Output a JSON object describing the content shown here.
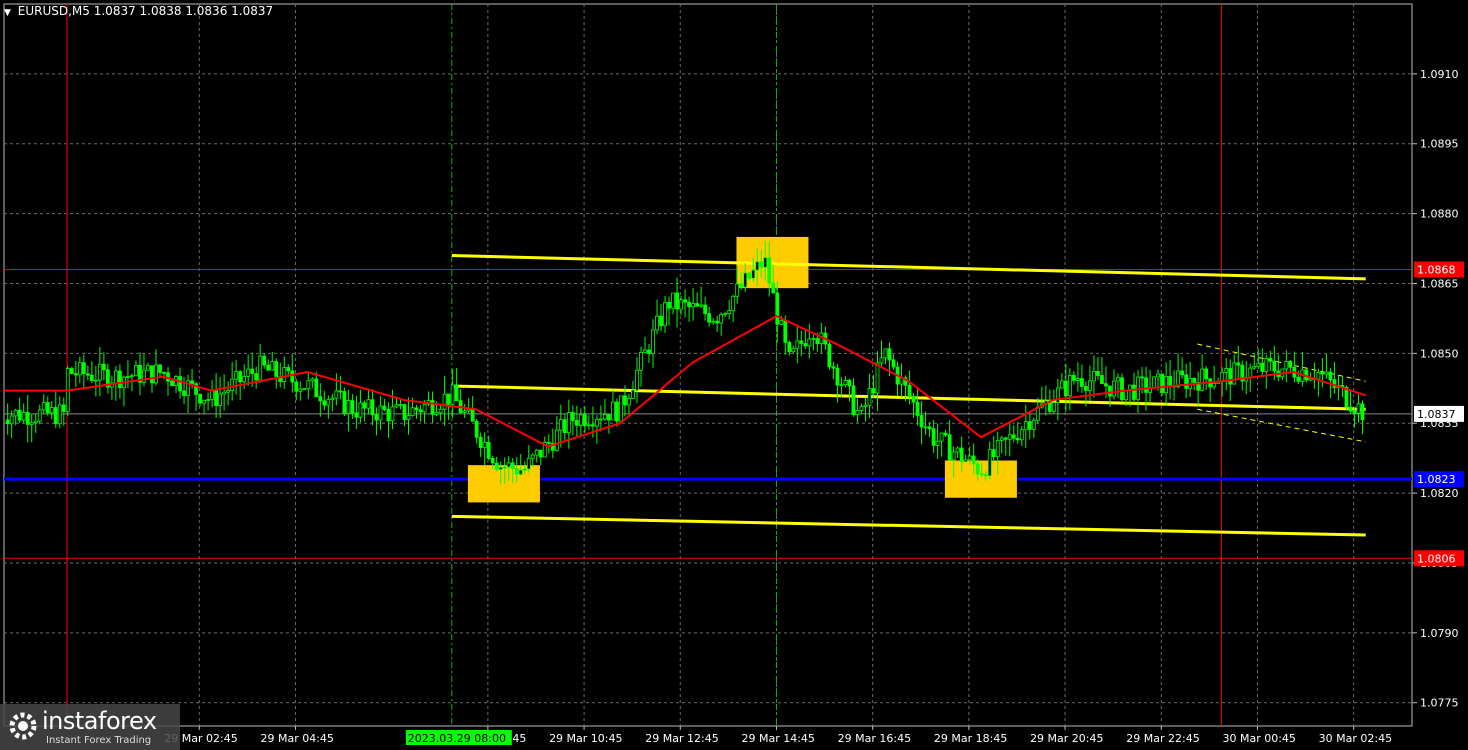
{
  "header": {
    "symbol_timeframe": "EURUSD,M5",
    "ohlc": "1.0837 1.0838 1.0836 1.0837"
  },
  "logo": {
    "brand": "instaforex",
    "tagline": "Instant Forex Trading"
  },
  "chart_data": {
    "type": "candlestick",
    "instrument": "EURUSD",
    "timeframe": "M5",
    "ylim": [
      1.077,
      1.0925
    ],
    "y_ticks": [
      "1.0910",
      "1.0895",
      "1.0880",
      "1.0865",
      "1.0850",
      "1.0835",
      "1.0820",
      "1.0805",
      "1.0790",
      "1.0775"
    ],
    "x_ticks": [
      "29 Mar 02:45",
      "29 Mar 04:45",
      "29 Mar 08:45",
      "29 Mar 10:45",
      "29 Mar 12:45",
      "29 Mar 14:45",
      "29 Mar 16:45",
      "29 Mar 18:45",
      "29 Mar 20:45",
      "29 Mar 22:45",
      "30 Mar 00:45",
      "30 Mar 02:45"
    ],
    "x_highlight_label": "2023.03.29 08:00",
    "grid": true,
    "colors": {
      "candles": "#00ff00",
      "moving_average": "#ff0000",
      "trend_lines": "#ffff00",
      "support": "#0000ff",
      "levels": "#ff0000",
      "signal_boxes": "#ffcc00",
      "price_badge": "#ffffff"
    },
    "price_labels": [
      {
        "value": 1.0868,
        "label": "1.0868",
        "type": "level"
      },
      {
        "value": 1.0837,
        "label": "1.0837",
        "type": "current"
      },
      {
        "value": 1.0823,
        "label": "1.0823",
        "type": "support"
      },
      {
        "value": 1.0806,
        "label": "1.0806",
        "type": "level"
      }
    ],
    "horizontal_levels": [
      {
        "value": 1.0868,
        "color": "red"
      },
      {
        "value": 1.0823,
        "color": "blue"
      },
      {
        "value": 1.0806,
        "color": "red"
      },
      {
        "value": 1.0837,
        "color": "gray"
      }
    ],
    "vertical_markers": [
      {
        "time": "29 Mar 00:00",
        "color": "red"
      },
      {
        "time": "29 Mar 08:00",
        "color": "green",
        "style": "dashed"
      },
      {
        "time": "29 Mar 14:45",
        "color": "green",
        "style": "dashed"
      },
      {
        "time": "30 Mar 00:00",
        "color": "red"
      }
    ],
    "trend_lines": [
      {
        "from": [
          "29 Mar 08:00",
          1.0871
        ],
        "to": [
          "30 Mar 03:00",
          1.0866
        ]
      },
      {
        "from": [
          "29 Mar 08:00",
          1.0843
        ],
        "to": [
          "30 Mar 03:00",
          1.0838
        ]
      },
      {
        "from": [
          "29 Mar 08:00",
          1.0815
        ],
        "to": [
          "30 Mar 03:00",
          1.0811
        ]
      }
    ],
    "signal_boxes": [
      {
        "time": "29 Mar 09:05",
        "low": 1.0818,
        "high": 1.0826
      },
      {
        "time": "29 Mar 14:40",
        "low": 1.0864,
        "high": 1.0875
      },
      {
        "time": "29 Mar 19:00",
        "low": 1.0819,
        "high": 1.0827
      }
    ],
    "price_path": [
      {
        "t": "29 Mar 00:00",
        "p": 1.0846
      },
      {
        "t": "29 Mar 01:00",
        "p": 1.0845
      },
      {
        "t": "29 Mar 02:00",
        "p": 1.0846
      },
      {
        "t": "29 Mar 03:00",
        "p": 1.084
      },
      {
        "t": "29 Mar 04:00",
        "p": 1.0847
      },
      {
        "t": "29 Mar 05:00",
        "p": 1.0843
      },
      {
        "t": "29 Mar 06:00",
        "p": 1.0838
      },
      {
        "t": "29 Mar 07:00",
        "p": 1.0837
      },
      {
        "t": "29 Mar 08:00",
        "p": 1.0841
      },
      {
        "t": "29 Mar 09:00",
        "p": 1.0826
      },
      {
        "t": "29 Mar 09:30",
        "p": 1.0825
      },
      {
        "t": "29 Mar 10:30",
        "p": 1.0836
      },
      {
        "t": "29 Mar 11:30",
        "p": 1.0838
      },
      {
        "t": "29 Mar 12:30",
        "p": 1.0861
      },
      {
        "t": "29 Mar 13:30",
        "p": 1.0858
      },
      {
        "t": "29 Mar 14:30",
        "p": 1.087
      },
      {
        "t": "29 Mar 15:00",
        "p": 1.0848
      },
      {
        "t": "29 Mar 15:30",
        "p": 1.0856
      },
      {
        "t": "29 Mar 16:30",
        "p": 1.0836
      },
      {
        "t": "29 Mar 17:00",
        "p": 1.085
      },
      {
        "t": "29 Mar 18:00",
        "p": 1.0832
      },
      {
        "t": "29 Mar 19:00",
        "p": 1.0825
      },
      {
        "t": "29 Mar 20:00",
        "p": 1.0836
      },
      {
        "t": "29 Mar 21:00",
        "p": 1.0845
      },
      {
        "t": "29 Mar 22:00",
        "p": 1.0842
      },
      {
        "t": "29 Mar 23:00",
        "p": 1.0844
      },
      {
        "t": "30 Mar 00:00",
        "p": 1.0845
      },
      {
        "t": "30 Mar 01:00",
        "p": 1.0847
      },
      {
        "t": "30 Mar 02:00",
        "p": 1.0846
      },
      {
        "t": "30 Mar 03:00",
        "p": 1.0837
      }
    ],
    "moving_average_path": [
      {
        "t": "29 Mar 00:00",
        "p": 1.0842
      },
      {
        "t": "29 Mar 02:00",
        "p": 1.0845
      },
      {
        "t": "29 Mar 03:00",
        "p": 1.0842
      },
      {
        "t": "29 Mar 05:00",
        "p": 1.0846
      },
      {
        "t": "29 Mar 07:00",
        "p": 1.084
      },
      {
        "t": "29 Mar 08:30",
        "p": 1.0838
      },
      {
        "t": "29 Mar 10:00",
        "p": 1.083
      },
      {
        "t": "29 Mar 11:30",
        "p": 1.0835
      },
      {
        "t": "29 Mar 13:00",
        "p": 1.0848
      },
      {
        "t": "29 Mar 14:45",
        "p": 1.0858
      },
      {
        "t": "29 Mar 16:00",
        "p": 1.0852
      },
      {
        "t": "29 Mar 17:30",
        "p": 1.0844
      },
      {
        "t": "29 Mar 19:00",
        "p": 1.0832
      },
      {
        "t": "29 Mar 20:30",
        "p": 1.084
      },
      {
        "t": "29 Mar 22:00",
        "p": 1.0842
      },
      {
        "t": "30 Mar 00:00",
        "p": 1.0844
      },
      {
        "t": "30 Mar 01:30",
        "p": 1.0846
      },
      {
        "t": "30 Mar 03:00",
        "p": 1.0841
      }
    ]
  }
}
